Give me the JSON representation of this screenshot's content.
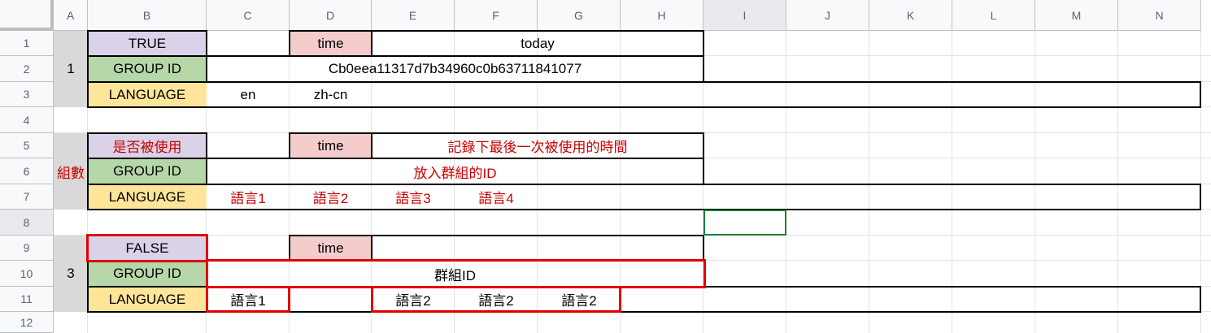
{
  "columns": [
    "A",
    "B",
    "C",
    "D",
    "E",
    "F",
    "G",
    "H",
    "I",
    "J",
    "K",
    "L",
    "M",
    "N"
  ],
  "rows": [
    "1",
    "2",
    "3",
    "4",
    "5",
    "6",
    "7",
    "8",
    "9",
    "10",
    "11",
    "12"
  ],
  "block1": {
    "merged_a": "1",
    "b1": "TRUE",
    "d1": "time",
    "e1": "today",
    "b2": "GROUP ID",
    "c2": "Cb0eea11317d7b34960c0b63711841077",
    "b3": "LANGUAGE",
    "c3": "en",
    "d3": "zh-cn"
  },
  "block2": {
    "merged_a": "組數",
    "b5": "是否被使用",
    "d5": "time",
    "e5": "記錄下最後一次被使用的時間",
    "b6": "GROUP ID",
    "c6": "放入群組的ID",
    "b7": "LANGUAGE",
    "c7": "語言1",
    "d7": "語言2",
    "e7": "語言3",
    "f7": "語言4"
  },
  "block3": {
    "merged_a": "3",
    "b9": "FALSE",
    "d9": "time",
    "b10": "GROUP ID",
    "c10": "群組ID",
    "b11": "LANGUAGE",
    "c11": "語言1",
    "e11": "語言2",
    "f11": "語言2",
    "g11": "語言2"
  },
  "colors": {
    "purple": "#d9d2e9",
    "green": "#b6d7a8",
    "pink": "#f4cccc",
    "yellow": "#ffe599",
    "gray": "#d9d9d9",
    "red_text": "#cc0000",
    "red_border": "#e00000",
    "selection": "#188038"
  }
}
